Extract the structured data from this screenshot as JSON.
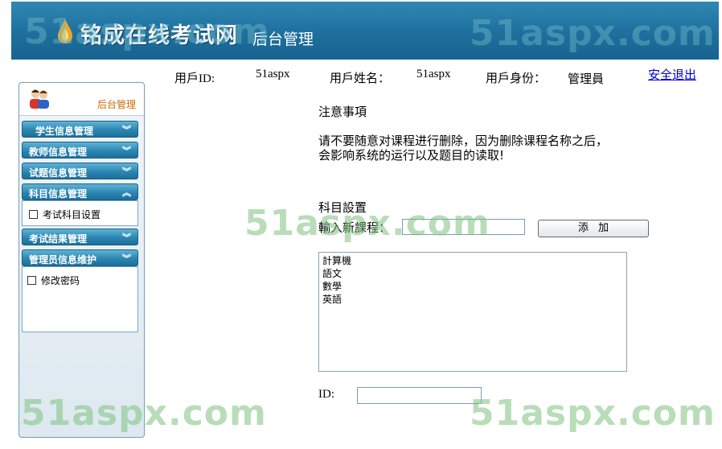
{
  "header": {
    "site_title": "铭成在线考试网",
    "subtitle": "后台管理",
    "watermark": "51aspx.com"
  },
  "userbar": {
    "id_label": "用戶ID:",
    "id_value": "51aspx",
    "name_label": "用戶姓名：",
    "name_value": "51aspx",
    "role_label": "用戶身份：",
    "role_value": "管理員",
    "logout": "安全退出"
  },
  "sidebar": {
    "title": "后台管理",
    "menus": [
      {
        "label": "学生信息管理",
        "chevron": "⌄⌄"
      },
      {
        "label": "教师信息管理",
        "chevron": "⌄⌄"
      },
      {
        "label": "试题信息管理",
        "chevron": "⌄⌄"
      },
      {
        "label": "科目信息管理",
        "chevron": "⌃⌃",
        "sub": "考试科目设置"
      },
      {
        "label": "考试结果管理",
        "chevron": "⌄⌄"
      },
      {
        "label": "管理员信息维护",
        "chevron": "⌄⌄",
        "sub": "修改密码"
      }
    ]
  },
  "main": {
    "notice_title": "注意事項",
    "notice_text": "请不要随意对课程进行删除，因为删除课程名称之后，会影响系统的运行以及题目的读取!",
    "subject_title": "科目設置",
    "new_course_label": "輸入新課程：",
    "new_course_value": "",
    "add_button": "添加",
    "courses": [
      "計算機",
      "語文",
      "數學",
      "英語"
    ],
    "id_label": "ID:",
    "id_value": ""
  },
  "colors": {
    "header_blue": "#1e6f9d",
    "menu_blue": "#2b86b2",
    "watermark_green": "#7fc37f",
    "accent_orange": "#d26a00"
  }
}
